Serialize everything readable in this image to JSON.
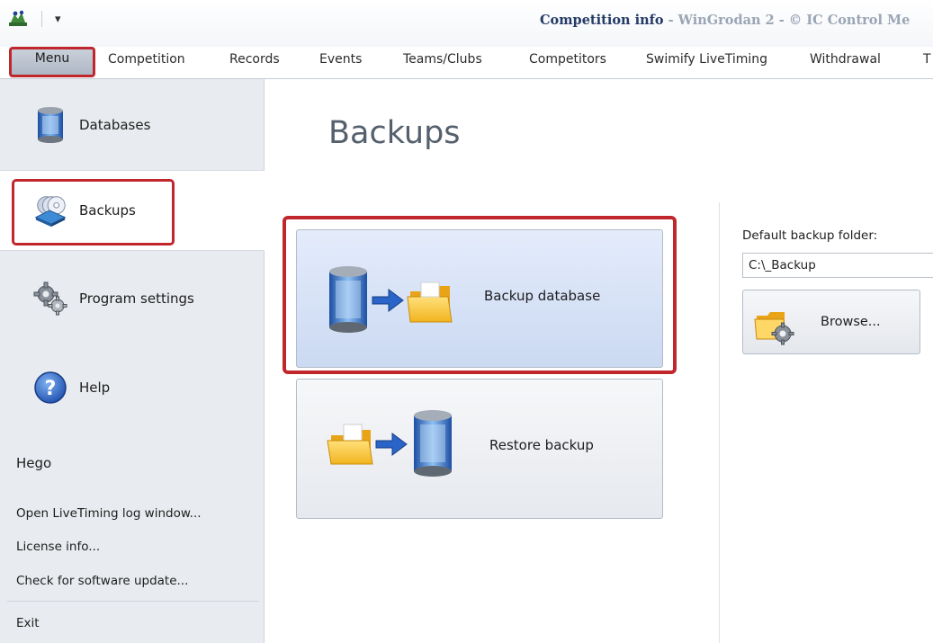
{
  "window": {
    "doc_title": "Competition info",
    "app_title": " - WinGrodan 2 - © IC Control Me"
  },
  "qat": {
    "dropdown_glyph": "▾"
  },
  "tabs": [
    {
      "label": "Menu"
    },
    {
      "label": "Competition"
    },
    {
      "label": "Records"
    },
    {
      "label": "Events"
    },
    {
      "label": "Teams/Clubs"
    },
    {
      "label": "Competitors"
    },
    {
      "label": "Swimify LiveTiming"
    },
    {
      "label": "Withdrawal"
    },
    {
      "label": "T"
    }
  ],
  "sidebar": {
    "items": [
      {
        "label": "Databases",
        "icon": "database-icon"
      },
      {
        "label": "Backups",
        "icon": "backup-discs-icon",
        "selected": true
      },
      {
        "label": "Program settings",
        "icon": "gears-icon"
      },
      {
        "label": "Help",
        "icon": "help-icon"
      }
    ],
    "section_title": "Hego",
    "links": [
      {
        "label": "Open LiveTiming log window..."
      },
      {
        "label": "License info..."
      },
      {
        "label": "Check for software update..."
      },
      {
        "label": "Exit"
      }
    ]
  },
  "main": {
    "title": "Backups",
    "backup_button": "Backup database",
    "restore_button": "Restore backup",
    "folder_label": "Default backup folder:",
    "folder_value": "C:\\_Backup",
    "browse_button": "Browse..."
  },
  "colors": {
    "highlight": "#c0272d",
    "accent_blue": "#2a64c9"
  }
}
